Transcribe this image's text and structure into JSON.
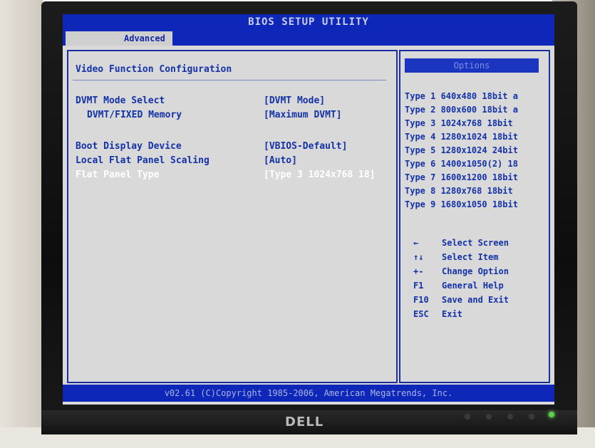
{
  "header": {
    "title": "BIOS SETUP UTILITY",
    "tabs": [
      {
        "label": "Advanced",
        "active": true
      }
    ]
  },
  "main": {
    "section_title": "Video Function Configuration",
    "settings": [
      {
        "label": "DVMT Mode Select",
        "value": "[DVMT Mode]"
      },
      {
        "label": "DVMT/FIXED Memory",
        "value": "[Maximum DVMT]"
      },
      {
        "label": "Boot Display Device",
        "value": "[VBIOS-Default]"
      },
      {
        "label": "Local Flat Panel Scaling",
        "value": "[Auto]"
      },
      {
        "label": "Flat Panel Type",
        "value": "[Type 3 1024x768 18]",
        "selected": true
      }
    ]
  },
  "options": {
    "header": "Options",
    "items": [
      "Type 1 640x480 18bit a",
      "Type 2 800x600 18bit a",
      "Type 3 1024x768 18bit",
      "Type 4 1280x1024 18bit",
      "Type 5 1280x1024 24bit",
      "Type 6 1400x1050(2) 18",
      "Type 7 1600x1200 18bit",
      "Type 8 1280x768 18bit",
      "Type 9 1680x1050 18bit"
    ]
  },
  "help_keys": [
    {
      "key": "←",
      "desc": "Select Screen"
    },
    {
      "key": "↑↓",
      "desc": "Select Item"
    },
    {
      "key": "+-",
      "desc": "Change Option"
    },
    {
      "key": "F1",
      "desc": "General Help"
    },
    {
      "key": "F10",
      "desc": "Save and Exit"
    },
    {
      "key": "ESC",
      "desc": "Exit"
    }
  ],
  "footer": {
    "copyright": "v02.61 (C)Copyright 1985-2006, American Megatrends, Inc."
  },
  "monitor": {
    "brand": "DELL"
  },
  "colors": {
    "bios_blue": "#0f27b8",
    "screen_gray": "#d9d9d9",
    "text_blue": "#1432a8",
    "selected_white": "#ffffff",
    "power_led": "#5bd24a"
  }
}
